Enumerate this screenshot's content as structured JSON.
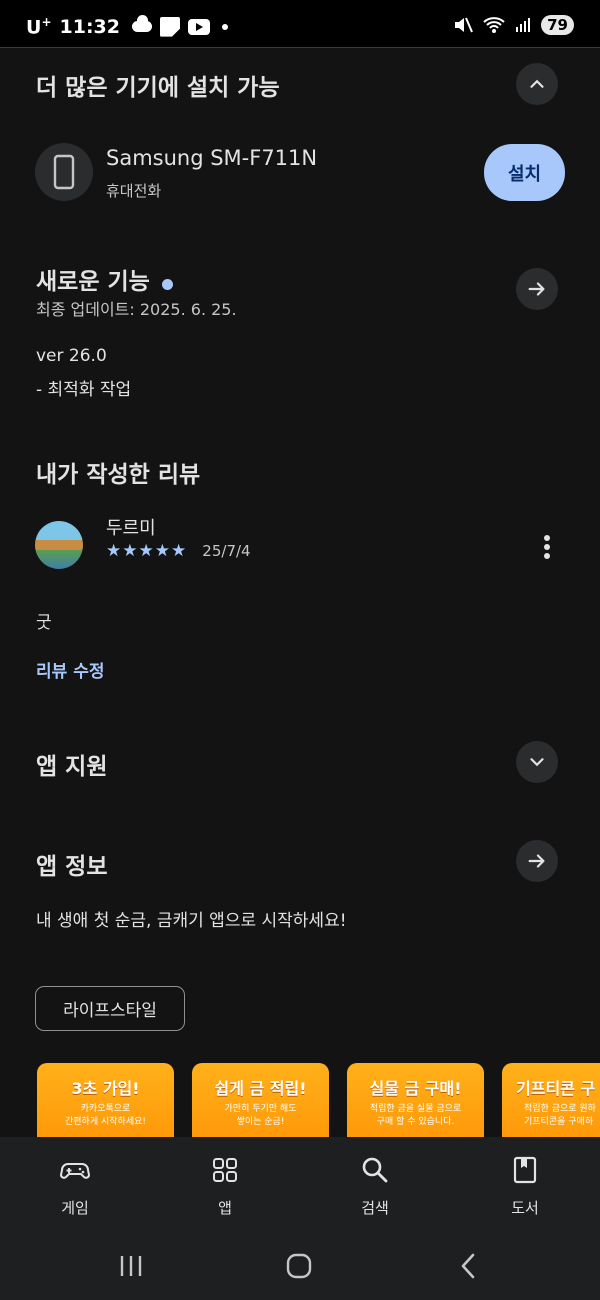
{
  "status_bar": {
    "carrier": "U",
    "carrier_sup": "+",
    "time": "11:32",
    "battery": "79"
  },
  "more_devices": {
    "title": "더 많은 기기에 설치 가능",
    "device_name": "Samsung SM-F711N",
    "device_type": "휴대전화",
    "install_label": "설치"
  },
  "whats_new": {
    "title": "새로운 기능",
    "updated": "최종 업데이트: 2025. 6. 25.",
    "version": "ver 26.0",
    "notes": "- 최적화 작업"
  },
  "my_review": {
    "title": "내가 작성한 리뷰",
    "author": "두르미",
    "stars": "★★★★★",
    "date": "25/7/4",
    "text": "굿",
    "edit_link": "리뷰 수정"
  },
  "app_support": {
    "title": "앱 지원"
  },
  "app_info": {
    "title": "앱 정보",
    "description": "내 생애 첫 순금, 금캐기 앱으로 시작하세요!",
    "category_chip": "라이프스타일"
  },
  "screenshots": [
    {
      "title": "3초 가입!",
      "sub1": "카카오톡으로",
      "sub2": "간편하게 시작하세요!"
    },
    {
      "title": "쉽게 금 적립!",
      "sub1": "가만히 두기만 해도",
      "sub2": "쌓이는 순금!"
    },
    {
      "title": "실물 금 구매!",
      "sub1": "적립한 금을 실물 금으로",
      "sub2": "구매 할 수 있습니다."
    },
    {
      "title": "기프티콘 구",
      "sub1": "적립한 금으로 원하",
      "sub2": "기프티콘을 구매하"
    }
  ],
  "bottom_nav": [
    {
      "label": "게임",
      "icon": "gamepad-icon"
    },
    {
      "label": "앱",
      "icon": "apps-grid-icon"
    },
    {
      "label": "검색",
      "icon": "search-icon"
    },
    {
      "label": "도서",
      "icon": "book-icon"
    }
  ],
  "colors": {
    "background": "#131314",
    "accent": "#a8c7fa",
    "screenshot_orange": "#ff9a00"
  }
}
